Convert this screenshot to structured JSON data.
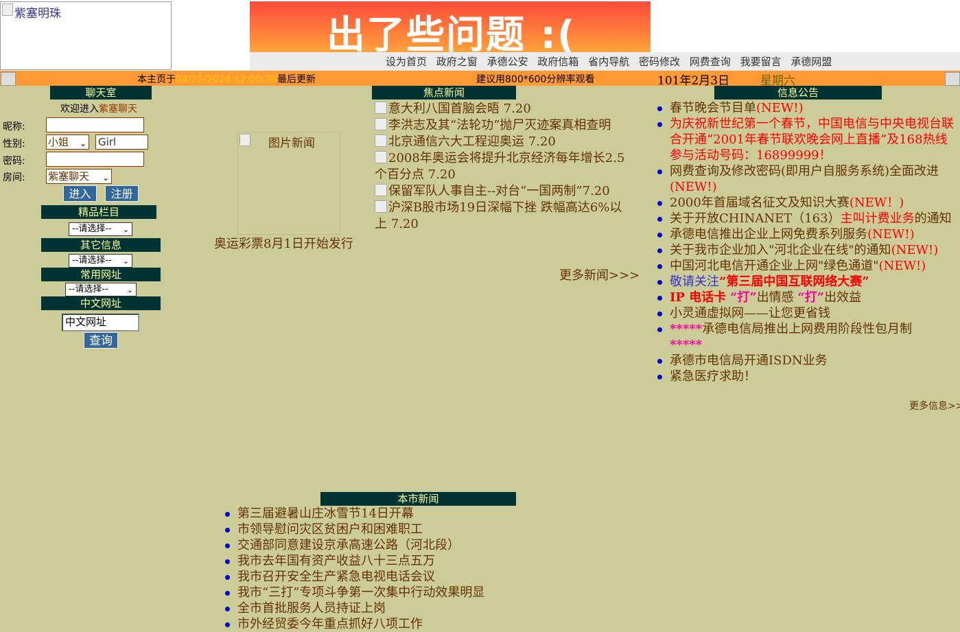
{
  "header": {
    "logo_alt": "紫塞明珠",
    "banner_text": "出了些问题 :(",
    "nav_links": [
      "设为首页",
      "政府之窗",
      "承德公安",
      "政府信箱",
      "省内导航",
      "密码修改",
      "网费查询",
      "我要留言",
      "承德网盟"
    ]
  },
  "infobar": {
    "updated_prefix": "本主页于",
    "updated_time": "04/25/2024 12:00:39",
    "updated_suffix": "最后更新",
    "resolution_note": "建议用800*600分辨率观看",
    "date": "101年2月3日",
    "weekday": "星期六"
  },
  "chat": {
    "title": "聊天室",
    "welcome_prefix": "欢迎进入",
    "welcome_name": "紫塞聊天",
    "nickname_label": "昵称:",
    "nickname_value": "",
    "gender_label": "性别:",
    "gender_value": "小姐",
    "gender_text_value": "Girl",
    "password_label": "密码:",
    "room_label": "房间:",
    "room_value": "紫塞聊天",
    "enter_button": "进入",
    "register_button": "注册"
  },
  "sidebar": {
    "featured_title": "精品栏目",
    "featured_select": "--请选择--",
    "other_title": "其它信息",
    "other_select": "--请选择--",
    "common_title": "常用网址",
    "common_select": "--请选择--",
    "chinese_title": "中文网址",
    "chinese_input_value": "中文网址",
    "query_button": "查询"
  },
  "photo_news": {
    "alt": "图片新闻",
    "caption": "奥运彩票8月1日开始发行"
  },
  "focus_news": {
    "title": "焦点新闻",
    "items": [
      "意大利八国首脑会晤 7.20",
      "李洪志及其“法轮功”抛尸灭迹案真相查明",
      "北京通信六大工程迎奥运 7.20",
      "2008年奥运会将提升北京经济每年增长2.5个百分点 7.20",
      "保留军队人事自主--对台“一国两制”7.20",
      "沪深B股市场19日深幅下挫 跌幅高达6%以上 7.20"
    ],
    "more": "更多新闻>>>"
  },
  "notices": {
    "title": "信息公告",
    "i1": "春节晚会节目单",
    "new": "(NEW!)",
    "i2": "为庆祝新世纪第一个春节，中国电信与中央电视台联合开通“2001年春节联欢晚会网上直播”及168热线参与活动号码：16899999！",
    "i3": "网费查询及修改密码(即用户自服务系统)全面改进",
    "i4": "2000年首届域名征文及知识大赛",
    "new2": "(NEW！)",
    "i5a": "关于开放CHINANET（163）",
    "i5b": "主叫计费业务",
    "i5c": "的通知",
    "i6": "承德电信推出企业上网免费系列服务",
    "i7": "关于我市企业加入\"河北企业在线\"的通知",
    "i8": "中国河北电信开通企业上网\"绿色通道\"",
    "i9a": "敬请关注",
    "i9b": "“第三届中国互联网络大赛”",
    "i10a": "IP 电话卡",
    "i10b": "“打”",
    "i10c": "出情感",
    "i10d": "“打”",
    "i10e": "出效益",
    "i11": "小灵通虚拟网——让您更省钱",
    "i12a": "*****",
    "i12b": "承德电信局推出上网费用阶段性包月制",
    "i12c": "*****",
    "i13": "承德市电信局开通ISDN业务",
    "i14": "紧急医疗求助！",
    "more": "更多信息>>>"
  },
  "local_news": {
    "title": "本市新闻",
    "items": [
      "第三届避暑山庄冰雪节14日开幕",
      "市领导慰问灾区贫困户和困难职工",
      "交通部同意建设京承高速公路（河北段）",
      "我市去年国有资产收益八十三点五万",
      "我市召开安全生产紧急电视电话会议",
      "我市“三打”专项斗争第一次集中行动效果明显",
      "全市首批服务人员持证上岗",
      "市外经贸委今年重点抓好八项工作"
    ]
  }
}
